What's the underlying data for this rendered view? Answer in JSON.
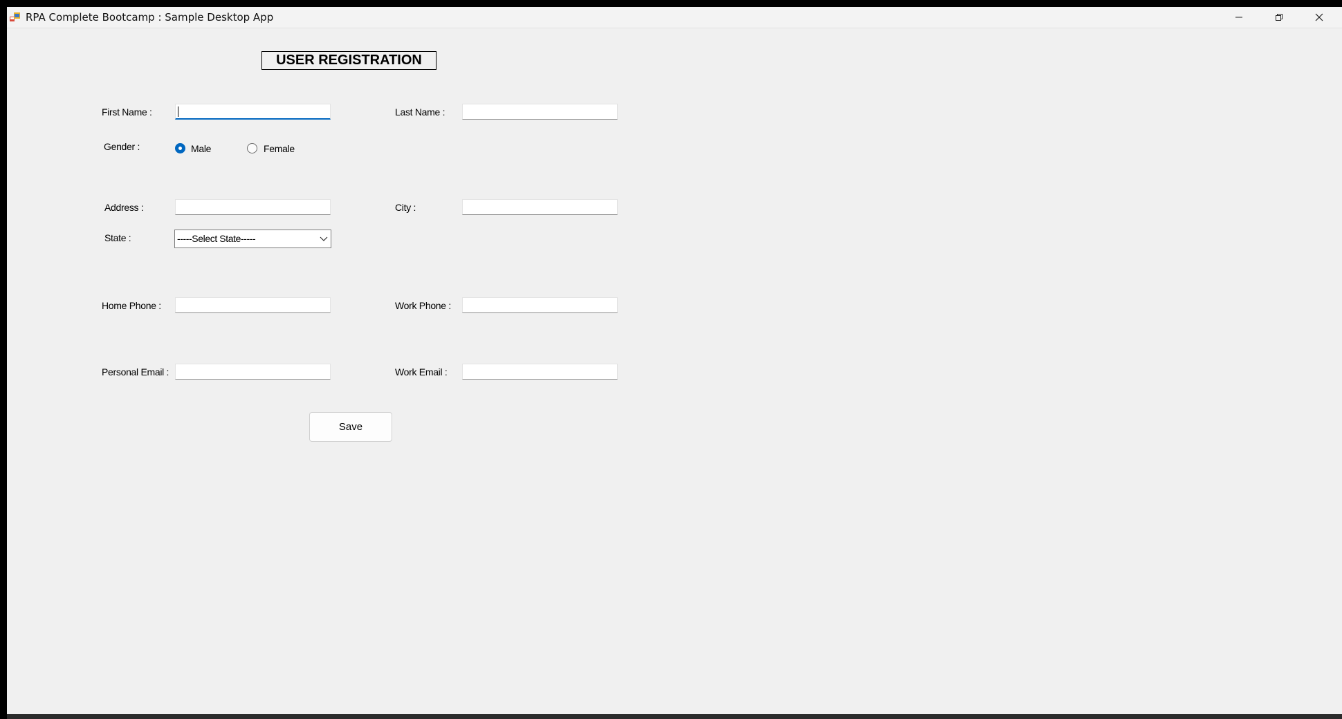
{
  "window": {
    "title": "RPA Complete Bootcamp : Sample Desktop App",
    "controls": {
      "minimize": "—",
      "restore": "❐",
      "close": "✕"
    }
  },
  "form": {
    "title": "USER REGISTRATION",
    "first_name": {
      "label": "First Name :",
      "value": ""
    },
    "last_name": {
      "label": "Last Name :",
      "value": ""
    },
    "gender": {
      "label": "Gender :",
      "options": [
        {
          "label": "Male",
          "selected": true
        },
        {
          "label": "Female",
          "selected": false
        }
      ]
    },
    "address": {
      "label": "Address :",
      "value": ""
    },
    "city": {
      "label": "City :",
      "value": ""
    },
    "state": {
      "label": "State :",
      "selected": "-----Select State-----"
    },
    "home_phone": {
      "label": "Home Phone :",
      "value": ""
    },
    "work_phone": {
      "label": "Work Phone :",
      "value": ""
    },
    "personal_email": {
      "label": "Personal Email :",
      "value": ""
    },
    "work_email": {
      "label": "Work Email :",
      "value": ""
    },
    "save_label": "Save"
  },
  "colors": {
    "accent": "#0067c0",
    "window_bg": "#f0f0f0"
  }
}
